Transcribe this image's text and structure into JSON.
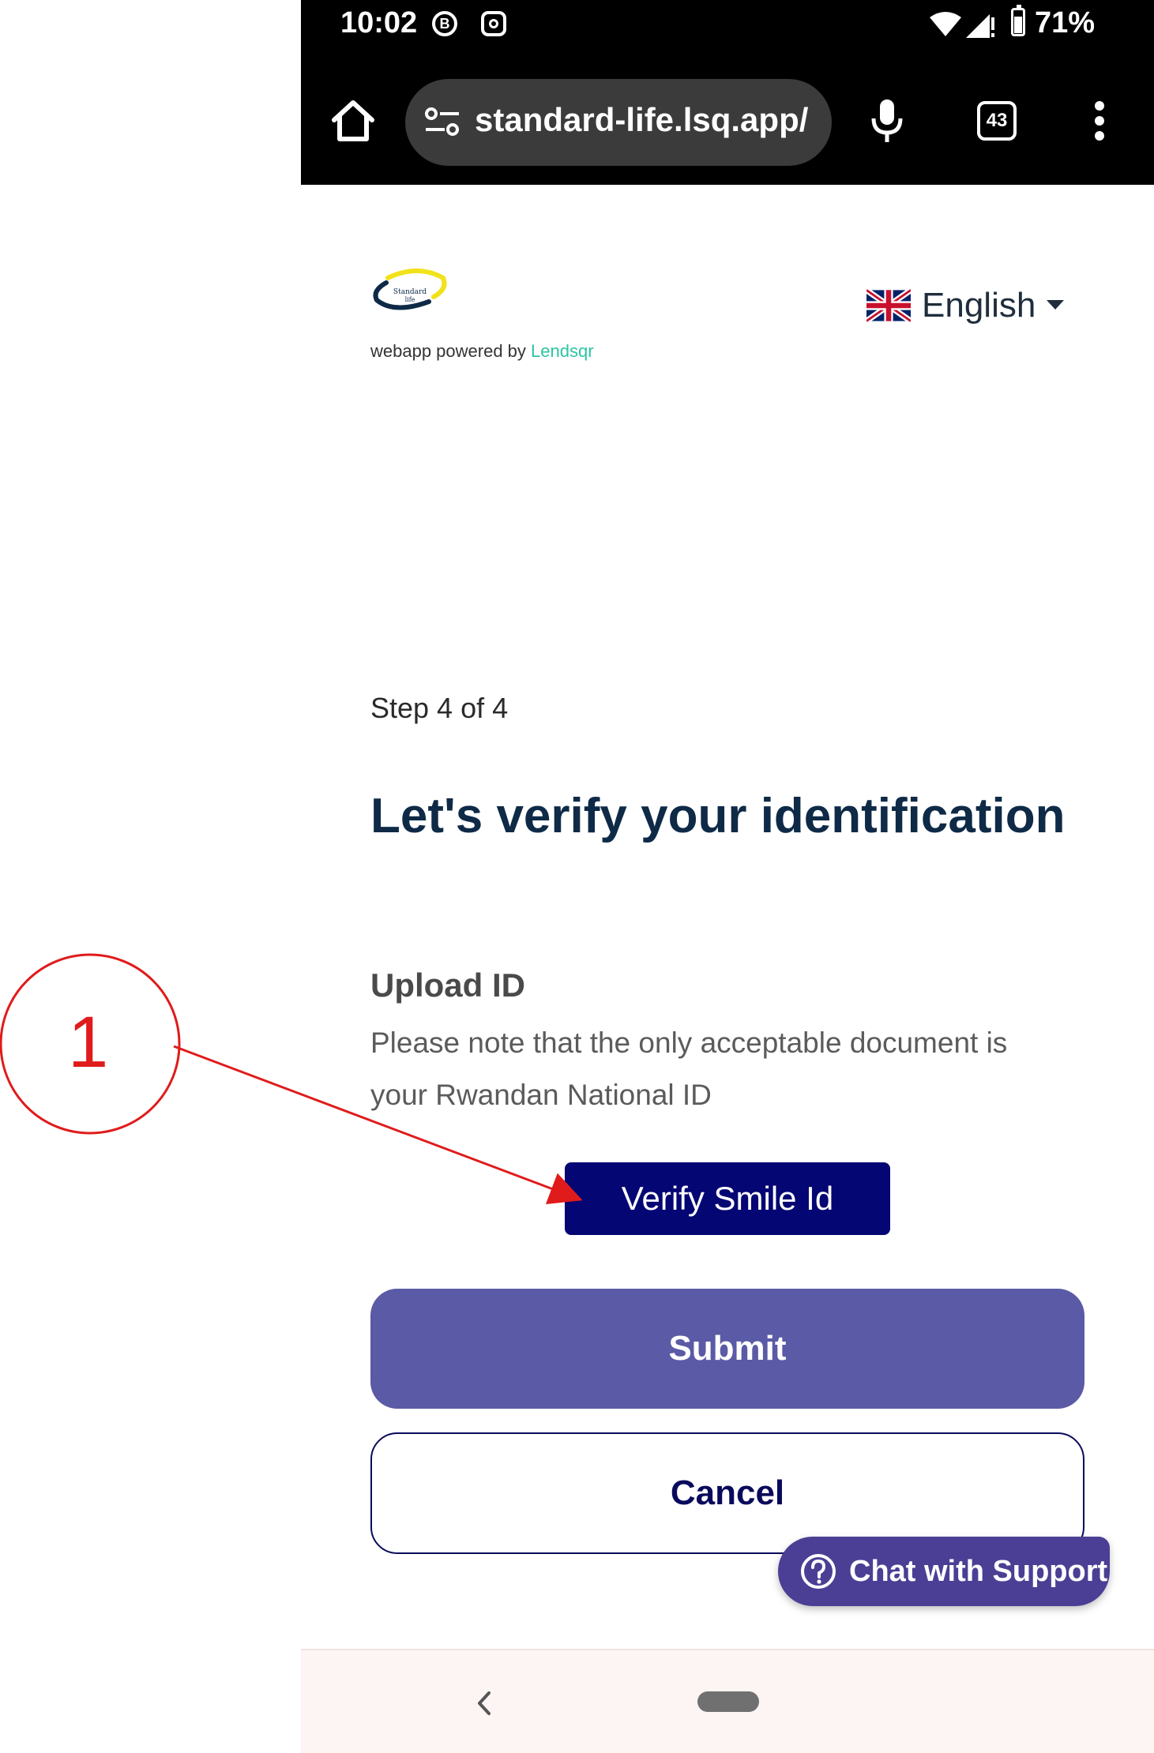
{
  "status_bar": {
    "time": "10:02",
    "battery": "71%",
    "icons": [
      "b-circle-icon",
      "instagram-icon",
      "wifi-icon",
      "signal-icon",
      "battery-icon"
    ]
  },
  "browser": {
    "url": "standard-life.lsq.app/",
    "tab_count": "43",
    "icons": [
      "home-icon",
      "tune-icon",
      "mic-icon",
      "tabs-icon",
      "more-vert-icon"
    ]
  },
  "header": {
    "logo_text": "Standard Life",
    "powered_prefix": "webapp powered by",
    "powered_brand": "Lendsqr",
    "language": "English"
  },
  "content": {
    "step": "Step 4 of 4",
    "title": "Let's verify your identification",
    "upload_heading": "Upload ID",
    "upload_note": "Please note that the only acceptable document is your Rwandan National ID"
  },
  "buttons": {
    "verify": "Verify Smile Id",
    "submit": "Submit",
    "cancel": "Cancel",
    "chat": "Chat with Support"
  },
  "annotation": {
    "label": "1"
  },
  "colors": {
    "verify_bg": "#040673",
    "submit_bg": "#5b5aa6",
    "chat_bg": "#4a3f94",
    "title": "#0e2a47",
    "brand": "#2bc5a2",
    "annotation": "#e01b1b"
  }
}
